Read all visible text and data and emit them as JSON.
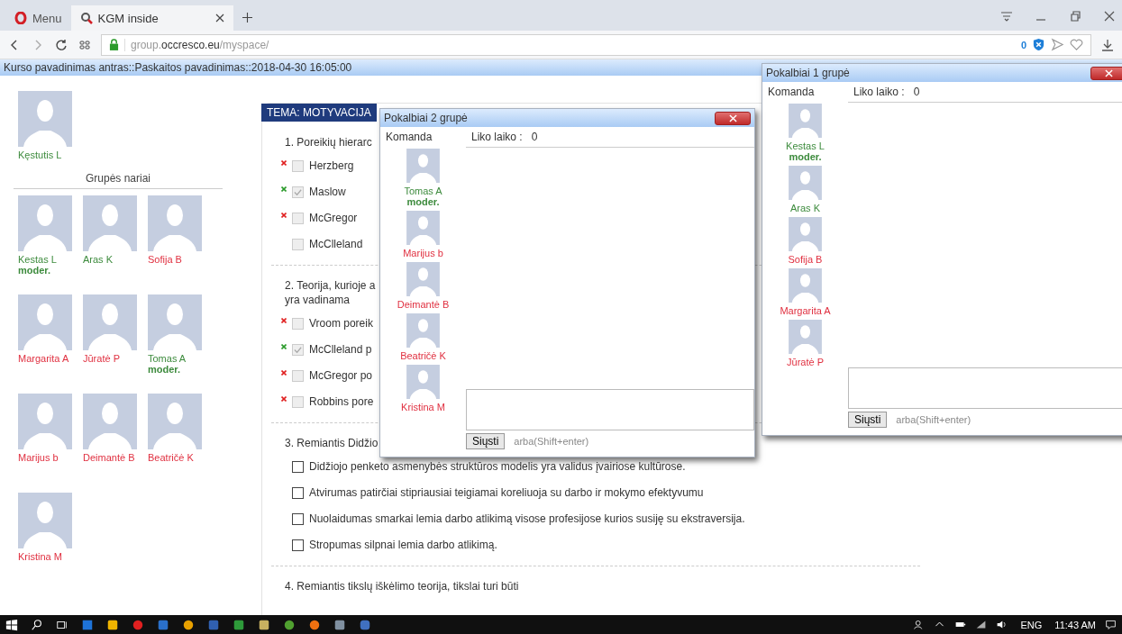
{
  "browser": {
    "tabs": [
      {
        "label": "Menu",
        "selected": false
      },
      {
        "label": "KGM inside",
        "selected": true
      }
    ],
    "address": {
      "prefix": "group.",
      "domain": "occresco.eu",
      "path": "/myspace/"
    },
    "blocked_count": "0"
  },
  "page_header": "Kurso pavadinimas antras::Paskaitos pavadinimas::2018-04-30 16:05:00",
  "current_user": {
    "name": "Kęstutis L",
    "color": "#3d8b3d"
  },
  "group": {
    "title": "Grupės nariai",
    "members": [
      {
        "name": "Kestas L",
        "role": "moder.",
        "color": "#3d8b3d"
      },
      {
        "name": "Aras K",
        "color": "#3d8b3d"
      },
      {
        "name": "Sofija B",
        "color": "#e03040"
      },
      {
        "name": "Margarita A",
        "color": "#e03040"
      },
      {
        "name": "Jūratė P",
        "color": "#e03040"
      },
      {
        "name": "Tomas A",
        "role": "moder.",
        "color": "#3d8b3d"
      },
      {
        "name": "Marijus b",
        "color": "#e03040"
      },
      {
        "name": "Deimantė B",
        "color": "#e03040"
      },
      {
        "name": "Beatričė K",
        "color": "#e03040"
      },
      {
        "name": "Kristina M",
        "color": "#e03040"
      }
    ]
  },
  "quiz": {
    "topic": "TEMA: MOTYVACIJA",
    "questions": [
      {
        "text": "1. Poreikių hierarc",
        "options": [
          {
            "text": "Herzberg",
            "color": "#e02020",
            "checked": false,
            "disabled": true
          },
          {
            "text": "Maslow",
            "color": "#2a9a2a",
            "checked": true,
            "disabled": true
          },
          {
            "text": "McGregor",
            "color": "#e02020",
            "checked": false,
            "disabled": true
          },
          {
            "text": "McClleland",
            "checked": false,
            "disabled": true
          }
        ]
      },
      {
        "text": "2. Teorija, kurioje a\nyra vadinama",
        "options": [
          {
            "text": "Vroom poreik",
            "color": "#e02020",
            "checked": false,
            "disabled": true
          },
          {
            "text": "McClleland p",
            "color": "#2a9a2a",
            "checked": true,
            "disabled": true
          },
          {
            "text": "McGregor po",
            "color": "#e02020",
            "checked": false,
            "disabled": true
          },
          {
            "text": "Robbins pore",
            "color": "#e02020",
            "checked": false,
            "disabled": true
          }
        ]
      },
      {
        "text": "3. Remiantis Didžio",
        "options": [
          {
            "text": "Didžiojo penketo asmenybės struktūros modelis yra validus įvairiose kultūrose.",
            "checked": false,
            "disabled": false
          },
          {
            "text": "Atvirumas patirčiai stipriausiai teigiamai koreliuoja su darbo ir mokymo efektyvumu",
            "checked": false,
            "disabled": false
          },
          {
            "text": "Nuolaidumas smarkai lemia darbo atlikimą visose profesijose kurios susiję su ekstraversija.",
            "checked": false,
            "disabled": false
          },
          {
            "text": "Stropumas silpnai lemia darbo atlikimą.",
            "checked": false,
            "disabled": false
          }
        ]
      },
      {
        "text": "4. Remiantis tikslų iškėlimo teorija, tikslai turi būti"
      }
    ]
  },
  "chats": [
    {
      "title": "Pokalbiai 1 grupė",
      "team_label": "Komanda",
      "time_label": "Liko laiko :",
      "time_value": "0",
      "send_label": "Siųsti",
      "hint": "arba(Shift+enter)",
      "members": [
        {
          "name": "Kestas L",
          "role": "moder.",
          "color": "#3d8b3d"
        },
        {
          "name": "Aras K",
          "color": "#3d8b3d"
        },
        {
          "name": "Sofija B",
          "color": "#e03040"
        },
        {
          "name": "Margarita A",
          "color": "#e03040"
        },
        {
          "name": "Jūratė P",
          "color": "#e03040"
        }
      ]
    },
    {
      "title": "Pokalbiai 2 grupė",
      "team_label": "Komanda",
      "time_label": "Liko laiko :",
      "time_value": "0",
      "send_label": "Siųsti",
      "hint": "arba(Shift+enter)",
      "members": [
        {
          "name": "Tomas A",
          "role": "moder.",
          "color": "#3d8b3d"
        },
        {
          "name": "Marijus b",
          "color": "#e03040"
        },
        {
          "name": "Deimantė B",
          "color": "#e03040"
        },
        {
          "name": "Beatričė K",
          "color": "#e03040"
        },
        {
          "name": "Kristina M",
          "color": "#e03040"
        }
      ]
    }
  ],
  "taskbar": {
    "language": "ENG",
    "time": "11:43 AM"
  }
}
